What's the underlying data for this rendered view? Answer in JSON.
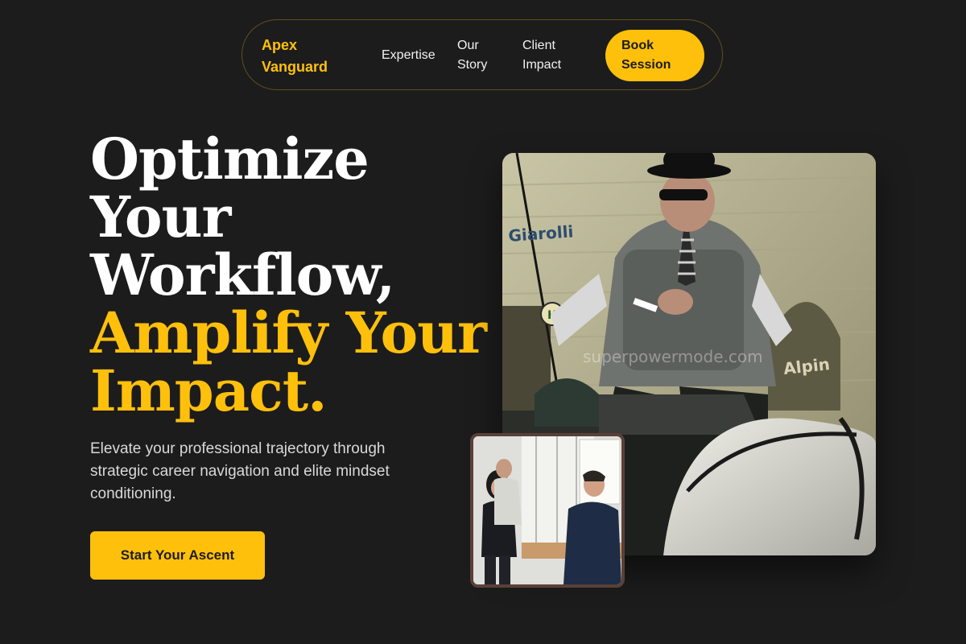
{
  "nav": {
    "brand": "Apex Vanguard",
    "links": [
      "Expertise",
      "Our Story",
      "Client Impact"
    ],
    "book_label": "Book Session"
  },
  "hero": {
    "title_lines": [
      "Optimize",
      "Your",
      "Workflow,"
    ],
    "title_accent_lines": [
      "Amplify Your",
      "Impact."
    ],
    "subtitle": "Elevate your professional trajectory through strategic career navigation and elite mindset conditioning.",
    "cta_label": "Start Your Ascent"
  },
  "images": {
    "main_watermark": "superpowermode.com",
    "main_signs": [
      "Giarolli",
      "Alpin",
      "H"
    ]
  },
  "colors": {
    "accent": "#ffc00c",
    "background": "#1c1c1c"
  }
}
